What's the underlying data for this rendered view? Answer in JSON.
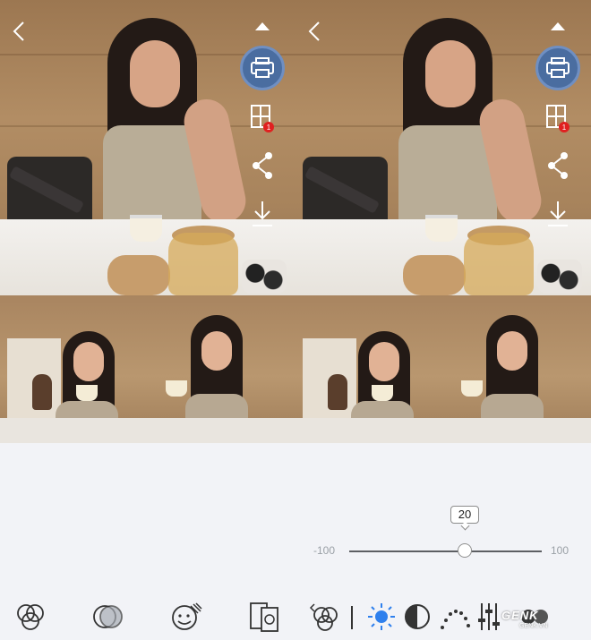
{
  "slider": {
    "value": "20",
    "min_label": "-100",
    "max_label": "100",
    "value_fraction": 0.6
  },
  "watermark": {
    "brand": "GENK",
    "sub": "GENK.VN"
  },
  "colors": {
    "accent": "#2f80ed",
    "print_button": "#4a6da0",
    "badge": "#e02020",
    "background": "#f2f3f7"
  },
  "icons": {
    "back": "chevron-left-icon",
    "collapse": "chevron-up-icon",
    "print": "printer-icon",
    "collage": "collage-icon",
    "share": "share-icon",
    "download": "download-icon",
    "badge": "1"
  },
  "toolbar": {
    "tools": [
      "filter-icon",
      "overlay-icon",
      "face-beauty-icon",
      "frame-icon",
      "back-filter-icon",
      "brightness-icon",
      "contrast-icon",
      "curve-icon",
      "adjust-icon",
      "more-icon"
    ]
  }
}
